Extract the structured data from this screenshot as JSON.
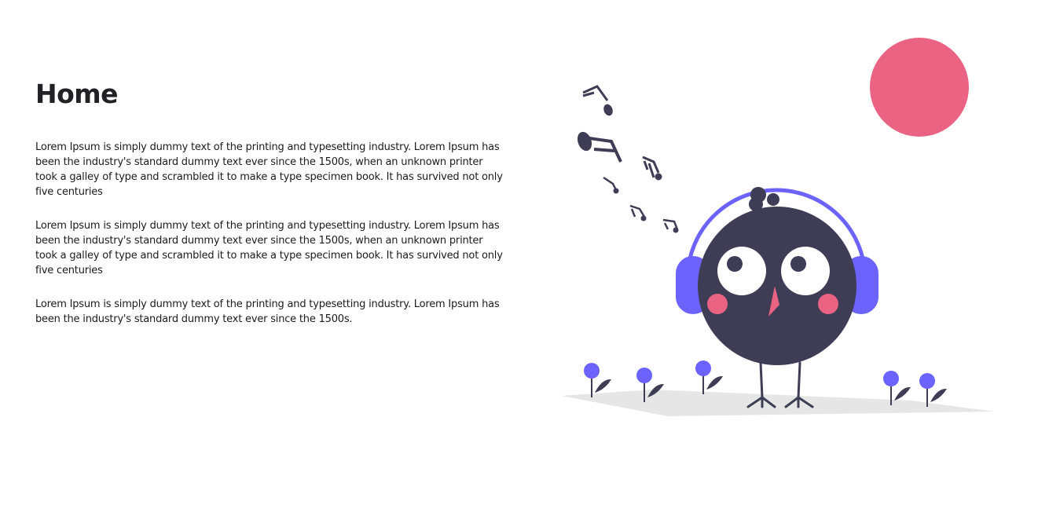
{
  "page": {
    "title": "Home",
    "paragraphs": [
      "Lorem Ipsum is simply dummy text of the printing and typesetting industry. Lorem Ipsum has been the industry's standard dummy text ever since the 1500s, when an unknown printer took a galley of type and scrambled it to make a type specimen book. It has survived not only five centuries",
      "Lorem Ipsum is simply dummy text of the printing and typesetting industry. Lorem Ipsum has been the industry's standard dummy text ever since the 1500s, when an unknown printer took a galley of type and scrambled it to make a type specimen book. It has survived not only five centuries",
      "Lorem Ipsum is simply dummy text of the printing and typesetting industry. Lorem Ipsum has been the industry's standard dummy text ever since the 1500s."
    ]
  },
  "illustration": {
    "subject": "bird-with-headphones-icon",
    "colors": {
      "body": "#3f3d56",
      "headphones": "#6c63ff",
      "sun": "#ea6382",
      "cheeks": "#ea6382",
      "beak": "#ea6382",
      "flowers": "#6c63ff",
      "ground": "#e6e6e6"
    }
  }
}
